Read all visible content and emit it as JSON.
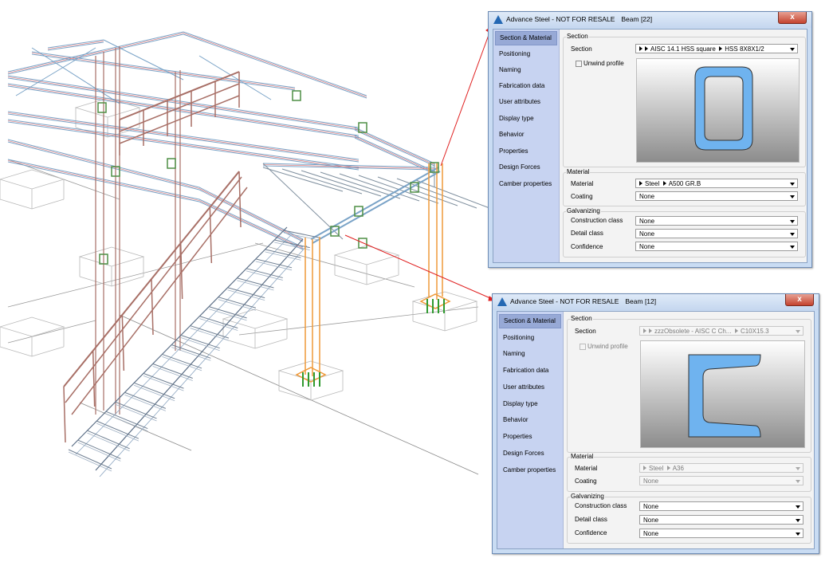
{
  "colors": {
    "accent": "#2468b3",
    "nav_bg": "#c7d3f1",
    "nav_active": "#97a9d6",
    "profile_fill": "#6fb3ef",
    "leader_line": "#e02020",
    "railing": "#a86f66",
    "steel_blue": "#7aa3c7",
    "column_orange": "#ef9a3a",
    "anchor_green": "#2f9a2f"
  },
  "dialogs": [
    {
      "title": "Advance Steel - NOT FOR RESALE",
      "object": "Beam [22]",
      "close_label": "x",
      "nav_items": [
        "Section & Material",
        "Positioning",
        "Naming",
        "Fabrication data",
        "User attributes",
        "Display type",
        "Behavior",
        "Properties",
        "Design Forces",
        "Camber properties"
      ],
      "active_nav": "Section & Material",
      "section_group": "Section",
      "section_label": "Section",
      "section_family": "AISC 14.1 HSS square",
      "section_size": "HSS 8X8X1/2",
      "unwind_label": "Unwind profile",
      "profile_shape": "hss-square",
      "material_group": "Material",
      "material_label": "Material",
      "material_family": "Steel",
      "material_grade": "A500 GR.B",
      "coating_label": "Coating",
      "coating_value": "None",
      "galv_group": "Galvanizing",
      "construction_label": "Construction class",
      "construction_value": "None",
      "detail_label": "Detail class",
      "detail_value": "None",
      "confidence_label": "Confidence",
      "confidence_value": "None",
      "enabled": true
    },
    {
      "title": "Advance Steel - NOT FOR RESALE",
      "object": "Beam [12]",
      "close_label": "x",
      "nav_items": [
        "Section & Material",
        "Positioning",
        "Naming",
        "Fabrication data",
        "User attributes",
        "Display type",
        "Behavior",
        "Properties",
        "Design Forces",
        "Camber properties"
      ],
      "active_nav": "Section & Material",
      "section_group": "Section",
      "section_label": "Section",
      "section_family": "zzzObsolete - AISC C Ch...",
      "section_size": "C10X15.3",
      "unwind_label": "Unwind profile",
      "profile_shape": "c-channel",
      "material_group": "Material",
      "material_label": "Material",
      "material_family": "Steel",
      "material_grade": "A36",
      "coating_label": "Coating",
      "coating_value": "None",
      "galv_group": "Galvanizing",
      "construction_label": "Construction class",
      "construction_value": "None",
      "detail_label": "Detail class",
      "detail_value": "None",
      "confidence_label": "Confidence",
      "confidence_value": "None",
      "enabled": false
    }
  ]
}
